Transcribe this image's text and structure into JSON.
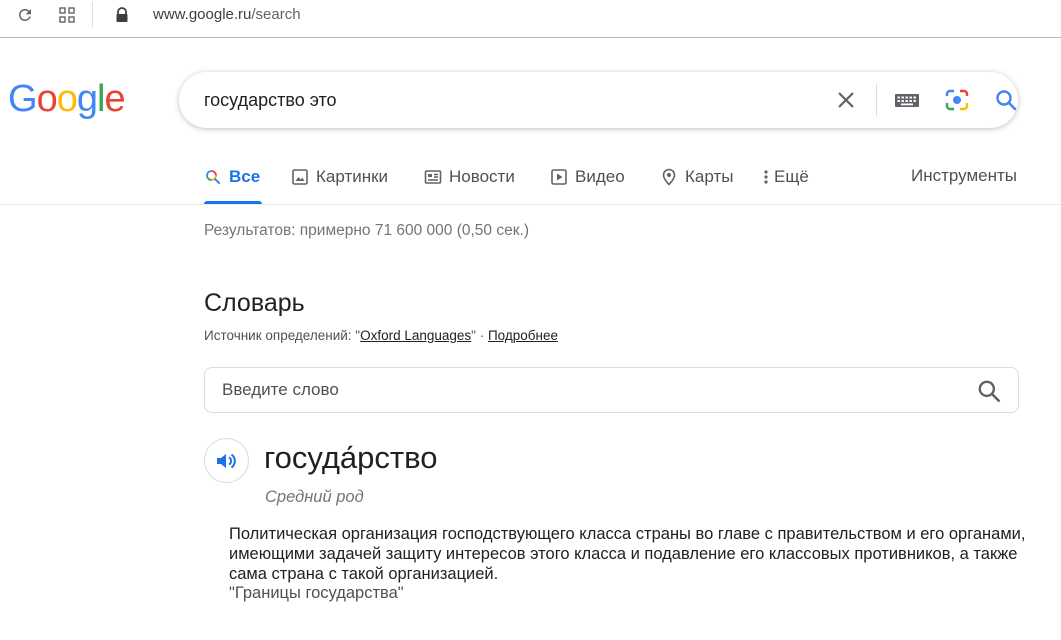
{
  "browser": {
    "url_host": "www.google.ru",
    "url_path": "/search"
  },
  "search": {
    "query": "государство это"
  },
  "tabs": [
    {
      "label": "Все",
      "icon": "search-icon"
    },
    {
      "label": "Картинки",
      "icon": "image-icon"
    },
    {
      "label": "Новости",
      "icon": "news-icon"
    },
    {
      "label": "Видео",
      "icon": "play-icon"
    },
    {
      "label": "Карты",
      "icon": "map-pin-icon"
    },
    {
      "label": "Ещё",
      "icon": "more-vert-icon"
    }
  ],
  "tools_label": "Инструменты",
  "results_stats": "Результатов: примерно 71 600 000 (0,50 сек.)",
  "dictionary": {
    "title": "Словарь",
    "source_prefix": "Источник определений: \"",
    "source_name": "Oxford Languages",
    "source_suffix": "\" · ",
    "more_link": "Подробнее",
    "input_placeholder": "Введите слово",
    "headword": "госуда́рство",
    "part_of_speech": "Средний род",
    "definition": "Политическая организация господствующего класса страны во главе с правительством и его органами, имеющими задачей защиту интересов этого класса и подавление его классовых противников, а также сама страна с такой организацией.",
    "example": "\"Границы государства\""
  },
  "colors": {
    "accent": "#1a73e8",
    "google_blue": "#4285f4",
    "google_red": "#ea4335",
    "google_yellow": "#fbbc05",
    "google_green": "#34a853"
  }
}
